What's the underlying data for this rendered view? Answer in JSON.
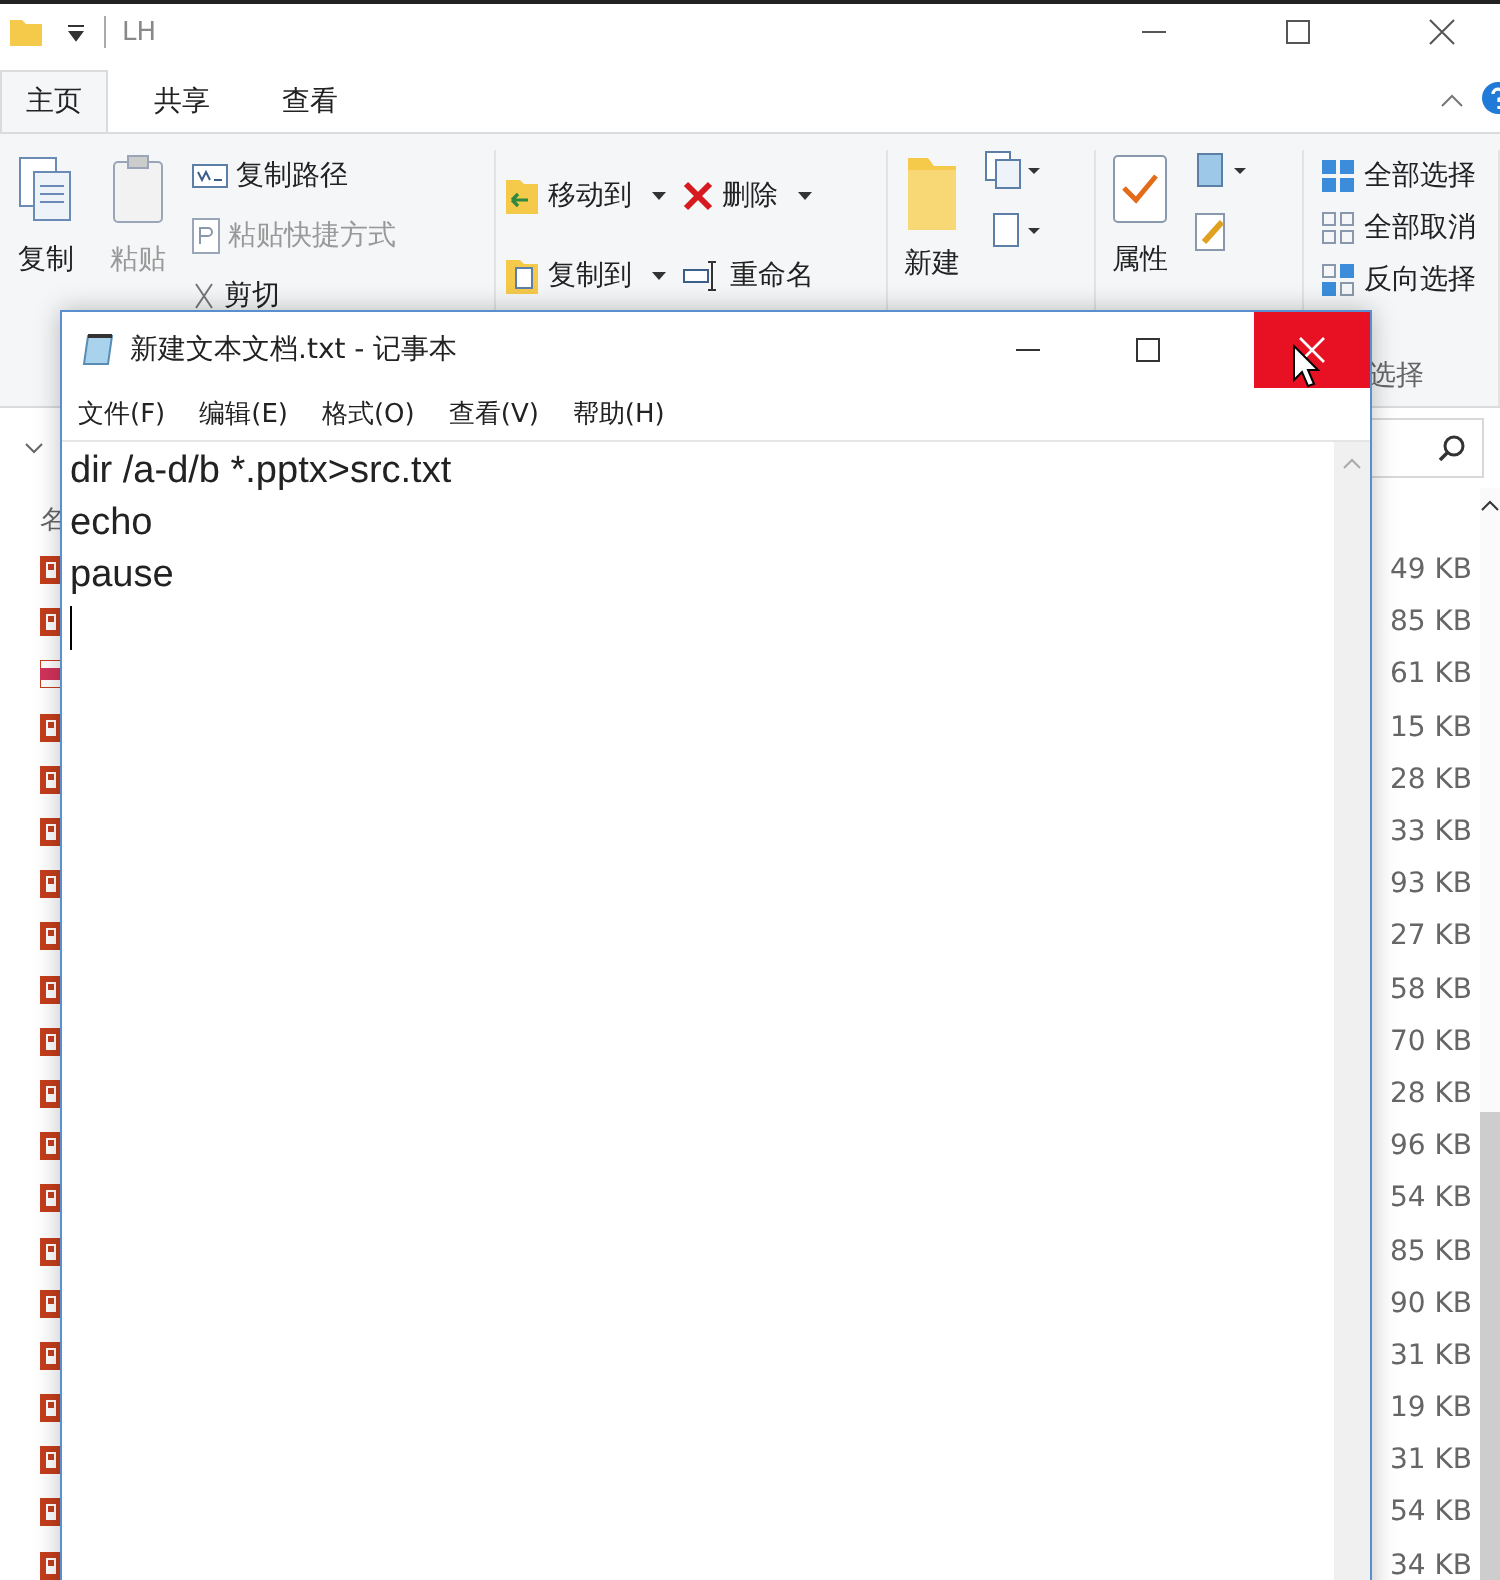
{
  "explorer": {
    "title": "LH",
    "tabs": [
      {
        "label": "主页",
        "selected": true
      },
      {
        "label": "共享",
        "selected": false
      },
      {
        "label": "查看",
        "selected": false
      }
    ],
    "ribbon": {
      "clipboard": {
        "copy": {
          "label": "复制",
          "disabled": false
        },
        "paste": {
          "label": "粘贴",
          "disabled": true
        },
        "copy_path": {
          "label": "复制路径",
          "disabled": false
        },
        "paste_shortcut": {
          "label": "粘贴快捷方式",
          "disabled": true
        },
        "cut": {
          "label": "剪切",
          "disabled": false
        }
      },
      "organize": {
        "move_to": "移动到",
        "copy_to": "复制到",
        "delete": "删除",
        "rename": "重命名"
      },
      "new": {
        "new_folder": "新建"
      },
      "open": {
        "properties": "属性"
      },
      "select": {
        "select_all": "全部选择",
        "select_none": "全部取消",
        "invert": "反向选择",
        "group_label": "选择"
      }
    },
    "file_list": {
      "column_1": "名",
      "rows": [
        {
          "kind": "ppt",
          "size": "49 KB"
        },
        {
          "kind": "ppt",
          "size": "85 KB"
        },
        {
          "kind": "pps",
          "size": "61 KB"
        },
        {
          "kind": "ppt",
          "size": "15 KB"
        },
        {
          "kind": "ppt",
          "size": "28 KB"
        },
        {
          "kind": "ppt",
          "size": "33 KB"
        },
        {
          "kind": "ppt",
          "size": "93 KB"
        },
        {
          "kind": "ppt",
          "size": "27 KB"
        },
        {
          "kind": "ppt",
          "size": "58 KB"
        },
        {
          "kind": "ppt",
          "size": "70 KB"
        },
        {
          "kind": "ppt",
          "size": "28 KB"
        },
        {
          "kind": "ppt",
          "size": "96 KB"
        },
        {
          "kind": "ppt",
          "size": "54 KB"
        },
        {
          "kind": "ppt",
          "size": "85 KB"
        },
        {
          "kind": "ppt",
          "size": "90 KB"
        },
        {
          "kind": "ppt",
          "size": "31 KB"
        },
        {
          "kind": "ppt",
          "size": "19 KB"
        },
        {
          "kind": "ppt",
          "size": "31 KB"
        },
        {
          "kind": "ppt",
          "size": "54 KB"
        },
        {
          "kind": "ppt",
          "size": "34 KB"
        }
      ]
    }
  },
  "notepad": {
    "title": "新建文本文档.txt - 记事本",
    "menu": [
      "文件(F)",
      "编辑(E)",
      "格式(O)",
      "查看(V)",
      "帮助(H)"
    ],
    "lines": [
      "dir /a-d/b *.pptx>src.txt",
      "echo",
      "pause"
    ]
  }
}
